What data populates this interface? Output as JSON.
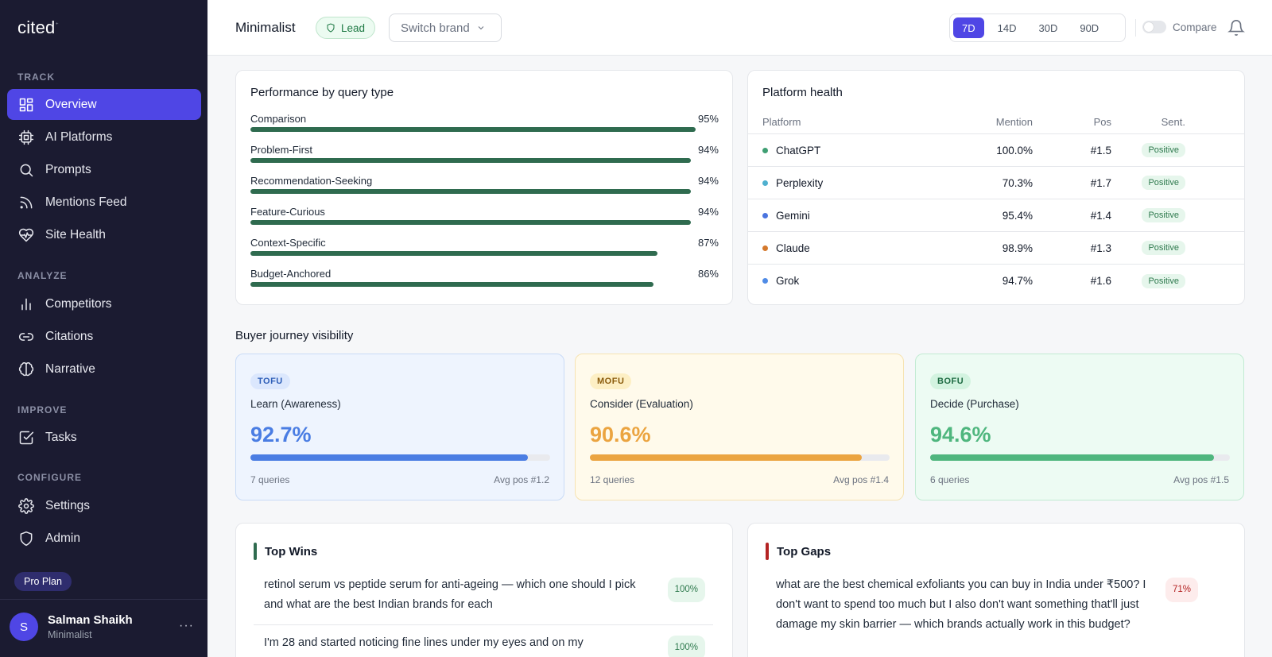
{
  "sidebar": {
    "logo": "cited",
    "logo_mark": "⁺",
    "sections": [
      {
        "label": "TRACK",
        "items": [
          {
            "label": "Overview",
            "icon": "grid-icon",
            "active": true
          },
          {
            "label": "AI Platforms",
            "icon": "cpu-icon"
          },
          {
            "label": "Prompts",
            "icon": "search-icon"
          },
          {
            "label": "Mentions Feed",
            "icon": "rss-icon"
          },
          {
            "label": "Site Health",
            "icon": "heart-pulse-icon"
          }
        ]
      },
      {
        "label": "ANALYZE",
        "items": [
          {
            "label": "Competitors",
            "icon": "bar-chart-icon"
          },
          {
            "label": "Citations",
            "icon": "link-icon"
          },
          {
            "label": "Narrative",
            "icon": "brain-icon"
          }
        ]
      },
      {
        "label": "IMPROVE",
        "items": [
          {
            "label": "Tasks",
            "icon": "checkbox-icon"
          }
        ]
      },
      {
        "label": "CONFIGURE",
        "items": [
          {
            "label": "Settings",
            "icon": "gear-icon"
          },
          {
            "label": "Admin",
            "icon": "shield-icon"
          }
        ]
      }
    ],
    "plan": "Pro Plan",
    "user": {
      "initial": "S",
      "name": "Salman Shaikh",
      "brand": "Minimalist",
      "more": "···"
    }
  },
  "header": {
    "brand": "Minimalist",
    "badge": "Lead",
    "switch_brand": "Switch brand",
    "ranges": [
      "7D",
      "14D",
      "30D",
      "90D"
    ],
    "active_range": "7D",
    "compare": "Compare"
  },
  "performance": {
    "title": "Performance by query type",
    "rows": [
      {
        "label": "Comparison",
        "pct": "95%",
        "value": 95
      },
      {
        "label": "Problem-First",
        "pct": "94%",
        "value": 94
      },
      {
        "label": "Recommendation-Seeking",
        "pct": "94%",
        "value": 94
      },
      {
        "label": "Feature-Curious",
        "pct": "94%",
        "value": 94
      },
      {
        "label": "Context-Specific",
        "pct": "87%",
        "value": 87
      },
      {
        "label": "Budget-Anchored",
        "pct": "86%",
        "value": 86
      }
    ]
  },
  "platform_health": {
    "title": "Platform health",
    "headers": {
      "platform": "Platform",
      "mention": "Mention",
      "pos": "Pos",
      "sent": "Sent."
    },
    "rows": [
      {
        "name": "ChatGPT",
        "color": "#3f9f73",
        "mention": "100.0%",
        "pos": "#1.5",
        "sent": "Positive"
      },
      {
        "name": "Perplexity",
        "color": "#4fb0cf",
        "mention": "70.3%",
        "pos": "#1.7",
        "sent": "Positive"
      },
      {
        "name": "Gemini",
        "color": "#4a74df",
        "mention": "95.4%",
        "pos": "#1.4",
        "sent": "Positive"
      },
      {
        "name": "Claude",
        "color": "#d4792c",
        "mention": "98.9%",
        "pos": "#1.3",
        "sent": "Positive"
      },
      {
        "name": "Grok",
        "color": "#4f8be6",
        "mention": "94.7%",
        "pos": "#1.6",
        "sent": "Positive"
      }
    ]
  },
  "journey": {
    "title": "Buyer journey visibility",
    "stages": [
      {
        "tag": "TOFU",
        "label": "Learn (Awareness)",
        "pct": "92.7%",
        "value": 92.7,
        "queries": "7 queries",
        "avg": "Avg pos #1.2",
        "color": "#4a7de3",
        "bg": "#eef4fe",
        "border": "#c9dbf6",
        "tag_bg": "#dbe7fd",
        "tag_color": "#2f5fb8"
      },
      {
        "tag": "MOFU",
        "label": "Consider (Evaluation)",
        "pct": "90.6%",
        "value": 90.6,
        "queries": "12 queries",
        "avg": "Avg pos #1.4",
        "color": "#eba440",
        "bg": "#fffaeb",
        "border": "#f6e3b2",
        "tag_bg": "#fdefc4",
        "tag_color": "#8a5b0c"
      },
      {
        "tag": "BOFU",
        "label": "Decide (Purchase)",
        "pct": "94.6%",
        "value": 94.6,
        "queries": "6 queries",
        "avg": "Avg pos #1.5",
        "color": "#4fb67e",
        "bg": "#edfbf3",
        "border": "#c2ebd3",
        "tag_bg": "#d3f3e0",
        "tag_color": "#1f6b43"
      }
    ]
  },
  "top_wins": {
    "title": "Top Wins",
    "accent": "#2f6b4f",
    "items": [
      {
        "text": "retinol serum vs peptide serum for anti-ageing — which one should I pick and what are the best Indian brands for each",
        "pct": "100%"
      },
      {
        "text": "I'm 28 and started noticing fine lines under my eyes and on my",
        "pct": "100%"
      }
    ]
  },
  "top_gaps": {
    "title": "Top Gaps",
    "accent": "#b42323",
    "items": [
      {
        "text": "what are the best chemical exfoliants you can buy in India under ₹500? I don't want to spend too much but I also don't want something that'll just damage my skin barrier — which brands actually work in this budget?",
        "pct": "71%"
      }
    ]
  }
}
